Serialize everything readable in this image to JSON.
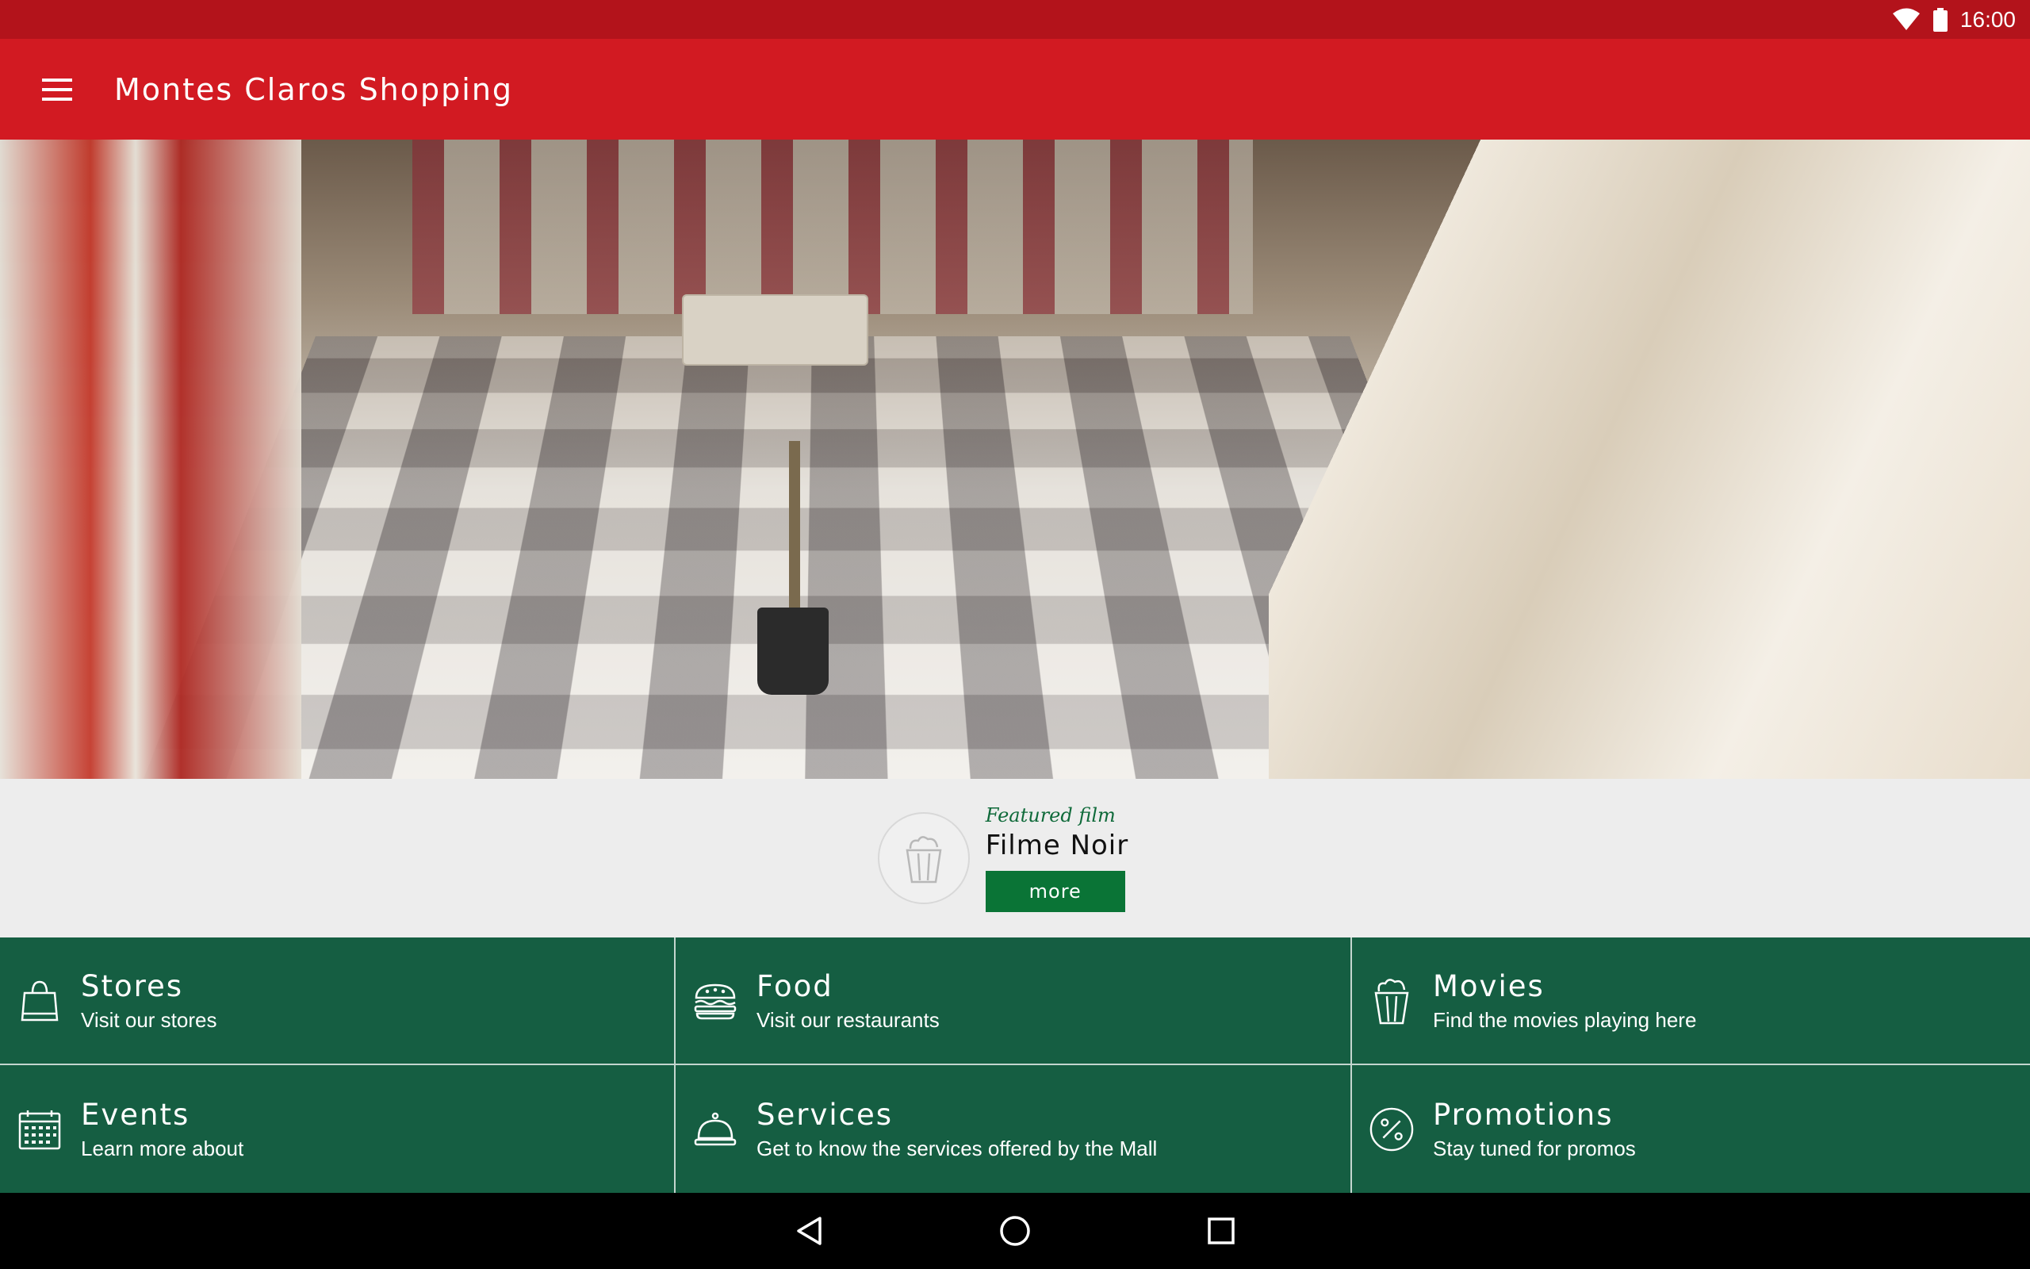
{
  "status_bar": {
    "time": "16:00"
  },
  "app_bar": {
    "title": "Montes Claros Shopping",
    "menu_icon": "hamburger-menu-icon"
  },
  "hero": {
    "image_description": ""
  },
  "featured": {
    "label": "Featured film",
    "title": "Filme Noir",
    "button_label": "more",
    "icon": "popcorn-icon"
  },
  "menu": {
    "items": [
      {
        "title": "Stores",
        "subtitle": "Visit our stores",
        "icon": "shopping-bag-icon"
      },
      {
        "title": "Food",
        "subtitle": "Visit our restaurants",
        "icon": "burger-icon"
      },
      {
        "title": "Movies",
        "subtitle": "Find the movies playing here",
        "icon": "popcorn-icon"
      },
      {
        "title": "Events",
        "subtitle": "Learn more about",
        "icon": "calendar-icon"
      },
      {
        "title": "Services",
        "subtitle": "Get to know the services offered by the Mall",
        "icon": "service-bell-icon"
      },
      {
        "title": "Promotions",
        "subtitle": "Stay tuned for promos",
        "icon": "percent-icon"
      }
    ]
  },
  "colors": {
    "status_bar": "#b3131b",
    "app_bar": "#d21a22",
    "menu_bg": "#155e42",
    "button_green": "#0a7436",
    "featured_label": "#0f6a3a"
  }
}
